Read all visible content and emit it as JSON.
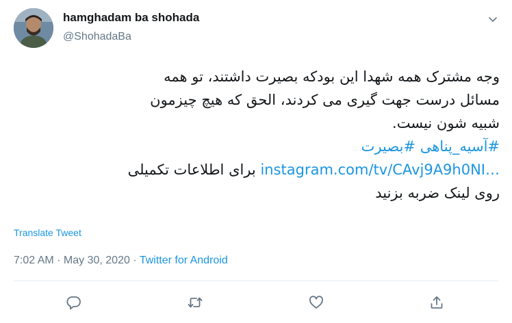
{
  "author": {
    "display_name": "hamghadam ba shohada",
    "handle": "@ShohadaBa",
    "avatar": "profile-photo"
  },
  "tweet": {
    "lines": [
      "وجه مشترک همه شهدا این بودکه بصیرت داشتند، تو همه",
      "مسائل درست جهت گیری می کردند، الحق که هیچ چیزمون",
      "شبیه شون نیست."
    ],
    "hashtags": [
      "#آسیه_پناهی",
      "#بصیرت"
    ],
    "link_text": "instagram.com/tv/CAvj9A9h0NI…",
    "link_suffix": " برای اطلاعات تکمیلی",
    "last_line": "روی لینک ضربه بزنید"
  },
  "translate_label": "Translate Tweet",
  "meta": {
    "time": "7:02 AM",
    "separator": " · ",
    "date": "May 30, 2020",
    "source": "Twitter for Android"
  },
  "icons": {
    "caret": "chevron-down-icon",
    "reply": "reply-icon",
    "retweet": "retweet-icon",
    "like": "like-icon",
    "share": "share-icon"
  },
  "colors": {
    "link": "#1b95e0",
    "secondary_text": "#657786",
    "primary_text": "#14171a",
    "divider": "#e6ecf0"
  }
}
